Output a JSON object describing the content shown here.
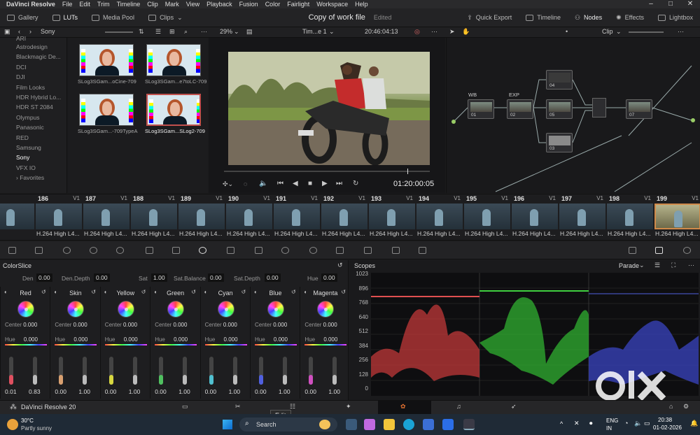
{
  "menu": {
    "app": "DaVinci Resolve",
    "items": [
      "File",
      "Edit",
      "Trim",
      "Timeline",
      "Clip",
      "Mark",
      "View",
      "Playback",
      "Fusion",
      "Color",
      "Fairlight",
      "Workspace",
      "Help"
    ]
  },
  "toolbar": {
    "gallery": "Gallery",
    "luts": "LUTs",
    "media_pool": "Media Pool",
    "clips": "Clips",
    "project_title": "Copy of work file",
    "status": "Edited",
    "quick_export": "Quick Export",
    "timeline": "Timeline",
    "nodes": "Nodes",
    "effects": "Effects",
    "lightbox": "Lightbox"
  },
  "subtoolbar": {
    "folder": "Sony",
    "zoom": "29%",
    "timeline_name": "Tim...e 1",
    "timecode": "20:46:04:13",
    "clip_mode": "Clip"
  },
  "bins": [
    "ARI",
    "Astrodesign",
    "Blackmagic De...",
    "DCI",
    "DJI",
    "Film Looks",
    "HDR Hybrid Lo...",
    "HDR ST 2084",
    "Olympus",
    "Panasonic",
    "RED",
    "Samsung",
    "Sony",
    "VFX IO",
    "Favorites"
  ],
  "stills": [
    {
      "label": "SLog3SGam...oCine-709"
    },
    {
      "label": "SLog3SGam...e7toLC-709"
    },
    {
      "label": "SLog3SGam...-709TypeA"
    },
    {
      "label": "SLog3SGam...SLog2-709"
    }
  ],
  "viewer": {
    "playhead_timecode": "01:20:00:05"
  },
  "nodes": [
    {
      "id": "01",
      "label": "WB"
    },
    {
      "id": "02",
      "label": "EXP"
    },
    {
      "id": "04",
      "label": ""
    },
    {
      "id": "05",
      "label": ""
    },
    {
      "id": "03",
      "label": ""
    },
    {
      "id": "07",
      "label": ""
    }
  ],
  "clips": [
    {
      "num": "186",
      "track": "V1",
      "codec": "H.264 High L4..."
    },
    {
      "num": "187",
      "track": "V1",
      "codec": "H.264 High L4..."
    },
    {
      "num": "188",
      "track": "V1",
      "codec": "H.264 High L4..."
    },
    {
      "num": "189",
      "track": "V1",
      "codec": "H.264 High L4..."
    },
    {
      "num": "190",
      "track": "V1",
      "codec": "H.264 High L4..."
    },
    {
      "num": "191",
      "track": "V1",
      "codec": "H.264 High L4..."
    },
    {
      "num": "192",
      "track": "V1",
      "codec": "H.264 High L4..."
    },
    {
      "num": "193",
      "track": "V1",
      "codec": "H.264 High L4..."
    },
    {
      "num": "194",
      "track": "V1",
      "codec": "H.264 High L4..."
    },
    {
      "num": "195",
      "track": "V1",
      "codec": "H.264 High L4..."
    },
    {
      "num": "196",
      "track": "V1",
      "codec": "H.264 High L4..."
    },
    {
      "num": "197",
      "track": "V1",
      "codec": "H.264 High L4..."
    },
    {
      "num": "198",
      "track": "V1",
      "codec": "H.264 High L4..."
    },
    {
      "num": "199",
      "track": "V1",
      "codec": "H.264 High L4..."
    }
  ],
  "colorslice": {
    "title": "ColorSlice",
    "den_label": "Den",
    "den": "0.00",
    "den_depth_label": "Den.Depth",
    "den_depth": "0.00",
    "sat_label": "Sat",
    "sat": "1.00",
    "sat_balance_label": "Sat.Balance",
    "sat_balance": "0.00",
    "sat_depth_label": "Sat.Depth",
    "sat_depth": "0.00",
    "hue_label": "Hue",
    "hue": "0.00",
    "columns": [
      {
        "name": "Red",
        "center": "0.000",
        "hue": "0.000",
        "v1": "0.01",
        "v2": "0.83",
        "color": "#e05060"
      },
      {
        "name": "Skin",
        "center": "0.000",
        "hue": "0.000",
        "v1": "0.00",
        "v2": "1.00",
        "color": "#d9a070"
      },
      {
        "name": "Yellow",
        "center": "0.000",
        "hue": "0.000",
        "v1": "0.00",
        "v2": "1.00",
        "color": "#d8d840"
      },
      {
        "name": "Green",
        "center": "0.000",
        "hue": "0.000",
        "v1": "0.00",
        "v2": "1.00",
        "color": "#50c060"
      },
      {
        "name": "Cyan",
        "center": "0.000",
        "hue": "0.000",
        "v1": "0.00",
        "v2": "1.00",
        "color": "#50c0d0"
      },
      {
        "name": "Blue",
        "center": "0.000",
        "hue": "0.000",
        "v1": "0.00",
        "v2": "1.00",
        "color": "#5060e0"
      },
      {
        "name": "Magenta",
        "center": "0.000",
        "hue": "0.000",
        "v1": "0.00",
        "v2": "1.00",
        "color": "#d050c0"
      }
    ],
    "center_label": "Center",
    "hue_short": "Hue"
  },
  "scopes": {
    "title": "Scopes",
    "mode": "Parade",
    "ticks": [
      "1023",
      "896",
      "768",
      "640",
      "512",
      "384",
      "256",
      "128",
      "0"
    ]
  },
  "bottombar": {
    "app": "DaVinci Resolve 20",
    "tooltip": "Edit"
  },
  "taskbar": {
    "temp": "30°C",
    "weather": "Partly sunny",
    "search": "Search",
    "lang1": "ENG",
    "lang2": "IN",
    "time": "20:38",
    "date": "01-02-2026"
  },
  "watermark": "OLX"
}
